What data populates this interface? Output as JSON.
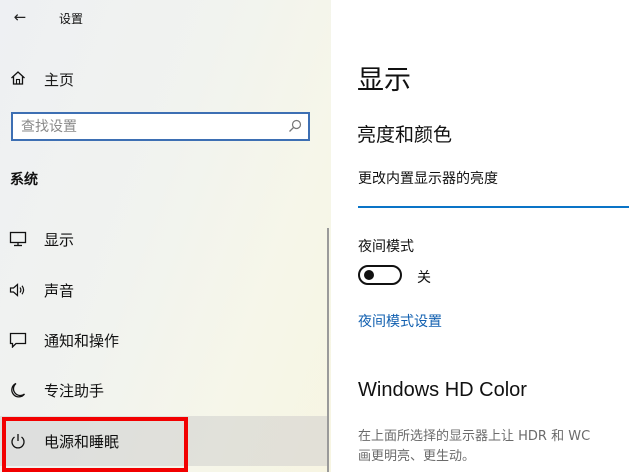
{
  "window": {
    "title": "设置"
  },
  "nav": {
    "home_label": "主页",
    "search_placeholder": "查找设置",
    "section_label": "系统",
    "items": [
      {
        "label": "显示",
        "icon": "monitor-icon"
      },
      {
        "label": "声音",
        "icon": "speaker-icon"
      },
      {
        "label": "通知和操作",
        "icon": "notification-icon"
      },
      {
        "label": "专注助手",
        "icon": "moon-icon"
      },
      {
        "label": "电源和睡眠",
        "icon": "power-icon",
        "selected": true
      }
    ]
  },
  "content": {
    "page_title": "显示",
    "subheading": "亮度和颜色",
    "brightness_label": "更改内置显示器的亮度",
    "night_mode_label": "夜间模式",
    "night_mode_state": "关",
    "night_mode_on": false,
    "night_mode_link": "夜间模式设置",
    "hd_color_title": "Windows HD Color",
    "hd_color_desc_line1": "在上面所选择的显示器上让 HDR 和 WC",
    "hd_color_desc_line2": "画更明亮、更生动。"
  },
  "colors": {
    "accent": "#0a74c7",
    "link": "#1260b0",
    "highlight_box": "#f20000"
  }
}
